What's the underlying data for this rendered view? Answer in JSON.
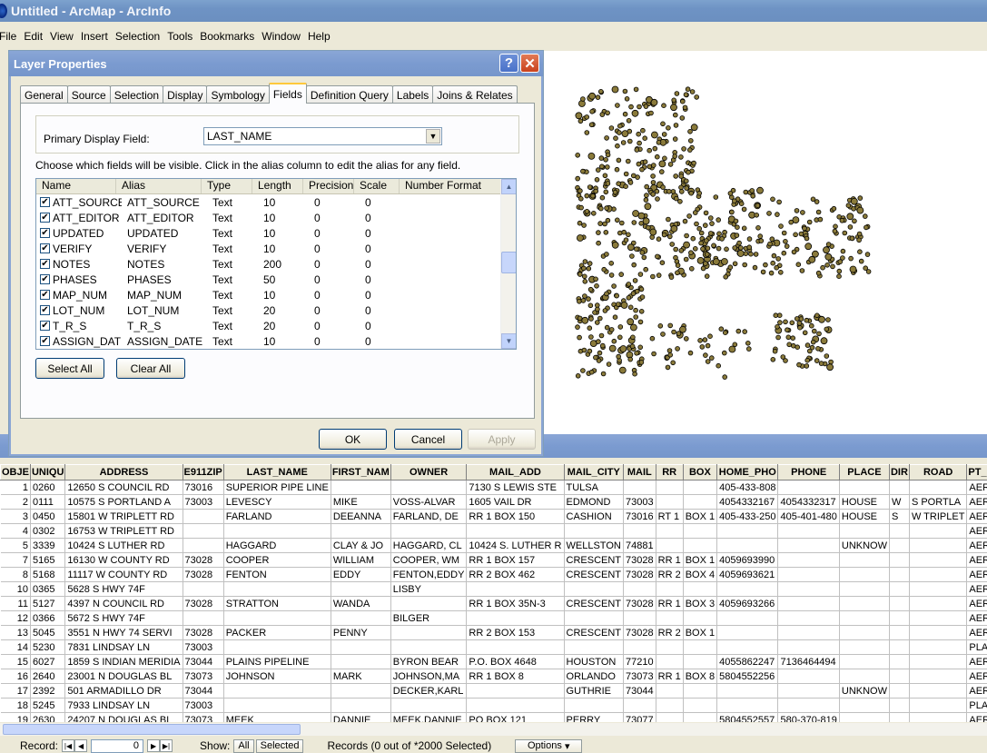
{
  "window": {
    "title": "Untitled - ArcMap - ArcInfo"
  },
  "menu": {
    "items": [
      {
        "label": "File"
      },
      {
        "label": "Edit"
      },
      {
        "label": "View"
      },
      {
        "label": "Insert"
      },
      {
        "label": "Selection"
      },
      {
        "label": "Tools"
      },
      {
        "label": "Bookmarks"
      },
      {
        "label": "Window"
      },
      {
        "label": "Help"
      }
    ]
  },
  "dialog": {
    "title": "Layer Properties",
    "help_label": "?",
    "close_label": "✕",
    "tabs": [
      "General",
      "Source",
      "Selection",
      "Display",
      "Symbology",
      "Fields",
      "Definition Query",
      "Labels",
      "Joins & Relates"
    ],
    "active_tab": "Fields",
    "primary_display_label": "Primary Display Field:",
    "primary_display_value": "LAST_NAME",
    "instructions": "Choose which fields will be visible. Click in the alias column to edit the alias for any field.",
    "field_columns": [
      "Name",
      "Alias",
      "Type",
      "Length",
      "Precision",
      "Scale",
      "Number Format"
    ],
    "fields": [
      {
        "name": "ATT_SOURCE",
        "alias": "ATT_SOURCE",
        "type": "Text",
        "length": "10",
        "precision": "0",
        "scale": "0",
        "checked": true
      },
      {
        "name": "ATT_EDITOR",
        "alias": "ATT_EDITOR",
        "type": "Text",
        "length": "10",
        "precision": "0",
        "scale": "0",
        "checked": true
      },
      {
        "name": "UPDATED",
        "alias": "UPDATED",
        "type": "Text",
        "length": "10",
        "precision": "0",
        "scale": "0",
        "checked": true
      },
      {
        "name": "VERIFY",
        "alias": "VERIFY",
        "type": "Text",
        "length": "10",
        "precision": "0",
        "scale": "0",
        "checked": true
      },
      {
        "name": "NOTES",
        "alias": "NOTES",
        "type": "Text",
        "length": "200",
        "precision": "0",
        "scale": "0",
        "checked": true
      },
      {
        "name": "PHASES",
        "alias": "PHASES",
        "type": "Text",
        "length": "50",
        "precision": "0",
        "scale": "0",
        "checked": true
      },
      {
        "name": "MAP_NUM",
        "alias": "MAP_NUM",
        "type": "Text",
        "length": "10",
        "precision": "0",
        "scale": "0",
        "checked": true
      },
      {
        "name": "LOT_NUM",
        "alias": "LOT_NUM",
        "type": "Text",
        "length": "20",
        "precision": "0",
        "scale": "0",
        "checked": true
      },
      {
        "name": "T_R_S",
        "alias": "T_R_S",
        "type": "Text",
        "length": "20",
        "precision": "0",
        "scale": "0",
        "checked": true
      },
      {
        "name": "ASSIGN_DATE",
        "alias": "ASSIGN_DATE",
        "type": "Text",
        "length": "10",
        "precision": "0",
        "scale": "0",
        "checked": true
      }
    ],
    "select_all_label": "Select All",
    "clear_all_label": "Clear All",
    "ok_label": "OK",
    "cancel_label": "Cancel",
    "apply_label": "Apply"
  },
  "map": {
    "point_fill": "#8a7a3a",
    "point_stroke": "#000000"
  },
  "table": {
    "columns": [
      "OBJE",
      "UNIQU",
      "ADDRESS",
      "E911ZIP",
      "LAST_NAME",
      "FIRST_NAM",
      "OWNER",
      "MAIL_ADD",
      "MAIL_CITY",
      "MAIL",
      "RR",
      "BOX",
      "HOME_PHO",
      "PHONE",
      "PLACE",
      "DIR",
      "ROAD",
      "PT_SOU"
    ],
    "rows": [
      [
        "1",
        "0260",
        "12650 S COUNCIL RD",
        "73016",
        "SUPERIOR PIPE LINE",
        "",
        "",
        "7130 S LEWIS STE",
        "TULSA",
        "",
        "",
        "",
        "405-433-808",
        "",
        "",
        "",
        "",
        "AERIAL"
      ],
      [
        "2",
        "0111",
        "10575 S PORTLAND A",
        "73003",
        "LEVESCY",
        "MIKE",
        "VOSS-ALVAR",
        "1605 VAIL DR",
        "EDMOND",
        "73003",
        "",
        "",
        "4054332167",
        "4054332317",
        "HOUSE",
        "W",
        "S PORTLA",
        "AERIAL"
      ],
      [
        "3",
        "0450",
        "15801 W TRIPLETT RD",
        "",
        "FARLAND",
        "DEEANNA",
        "FARLAND, DE",
        "RR 1 BOX 150",
        "CASHION",
        "73016",
        "RT 1",
        "BOX 1",
        "405-433-250",
        "405-401-480",
        "HOUSE",
        "S",
        "W TRIPLET",
        "AERIAL"
      ],
      [
        "4",
        "0302",
        "16753 W TRIPLETT RD",
        "",
        "",
        "",
        "",
        "",
        "",
        "",
        "",
        "",
        "",
        "",
        "",
        "",
        "",
        "AERIAL"
      ],
      [
        "5",
        "3339",
        "10424 S LUTHER RD",
        "",
        "HAGGARD",
        "CLAY & JO",
        "HAGGARD, CL",
        "10424 S. LUTHER R",
        "WELLSTON",
        "74881",
        "",
        "",
        "",
        "",
        "UNKNOW",
        "",
        "",
        "AERIAL"
      ],
      [
        "7",
        "5165",
        "16130 W COUNTY RD",
        "73028",
        "COOPER",
        "WILLIAM",
        "COOPER, WM",
        "RR 1 BOX 157",
        "CRESCENT",
        "73028",
        "RR 1",
        "BOX 1",
        "4059693990",
        "",
        "",
        "",
        "",
        "AERIAL"
      ],
      [
        "8",
        "5168",
        "11117 W COUNTY RD",
        "73028",
        "FENTON",
        "EDDY",
        "FENTON,EDDY",
        "RR 2 BOX 462",
        "CRESCENT",
        "73028",
        "RR 2",
        "BOX 4",
        "4059693621",
        "",
        "",
        "",
        "",
        "AERIAL"
      ],
      [
        "10",
        "0365",
        "5628 S HWY 74F",
        "",
        "",
        "",
        "LISBY",
        "",
        "",
        "",
        "",
        "",
        "",
        "",
        "",
        "",
        "",
        "AERIAL"
      ],
      [
        "11",
        "5127",
        "4397 N COUNCIL RD",
        "73028",
        "STRATTON",
        "WANDA",
        "",
        "RR 1 BOX 35N-3",
        "CRESCENT",
        "73028",
        "RR 1",
        "BOX 3",
        "4059693266",
        "",
        "",
        "",
        "",
        "AERIAL"
      ],
      [
        "12",
        "0366",
        "5672 S HWY 74F",
        "",
        "",
        "",
        "BILGER",
        "",
        "",
        "",
        "",
        "",
        "",
        "",
        "",
        "",
        "",
        "AERIAL"
      ],
      [
        "13",
        "5045",
        "3551 N HWY 74 SERVI",
        "73028",
        "PACKER",
        "PENNY",
        "",
        "RR 2 BOX 153",
        "CRESCENT",
        "73028",
        "RR 2",
        "BOX 1",
        "",
        "",
        "",
        "",
        "",
        "AERIAL"
      ],
      [
        "14",
        "5230",
        "7831 LINDSAY LN",
        "73003",
        "",
        "",
        "",
        "",
        "",
        "",
        "",
        "",
        "",
        "",
        "",
        "",
        "",
        "PLAT"
      ],
      [
        "15",
        "6027",
        "1859 S INDIAN MERIDIA",
        "73044",
        "PLAINS PIPELINE",
        "",
        "BYRON BEAR",
        "P.O. BOX 4648",
        "HOUSTON",
        "77210",
        "",
        "",
        "4055862247",
        "7136464494",
        "",
        "",
        "",
        "AERIAL"
      ],
      [
        "16",
        "2640",
        "23001 N DOUGLAS BL",
        "73073",
        "JOHNSON",
        "MARK",
        "JOHNSON,MA",
        "RR 1 BOX 8",
        "ORLANDO",
        "73073",
        "RR 1",
        "BOX 8",
        "5804552256",
        "",
        "",
        "",
        "",
        "AERIAL"
      ],
      [
        "17",
        "2392",
        "501 ARMADILLO DR",
        "73044",
        "",
        "",
        "DECKER,KARL",
        "",
        "GUTHRIE",
        "73044",
        "",
        "",
        "",
        "",
        "UNKNOW",
        "",
        "",
        "AERIAL"
      ],
      [
        "18",
        "5245",
        "7933 LINDSAY LN",
        "73003",
        "",
        "",
        "",
        "",
        "",
        "",
        "",
        "",
        "",
        "",
        "",
        "",
        "",
        "PLAT"
      ],
      [
        "19",
        "2630",
        "24207 N DOUGLAS BL",
        "73073",
        "MEEK",
        "DANNIE",
        "MEEK,DANNIE",
        "PO BOX 121",
        "PERRY",
        "73077",
        "",
        "",
        "5804552557",
        "580-370-819",
        "",
        "",
        "",
        "AERIAL"
      ]
    ]
  },
  "record_bar": {
    "record_label": "Record:",
    "record_value": "0",
    "show_label": "Show:",
    "all_label": "All",
    "selected_label": "Selected",
    "records_status": "Records (0 out of *2000 Selected)",
    "options_label": "Options"
  }
}
